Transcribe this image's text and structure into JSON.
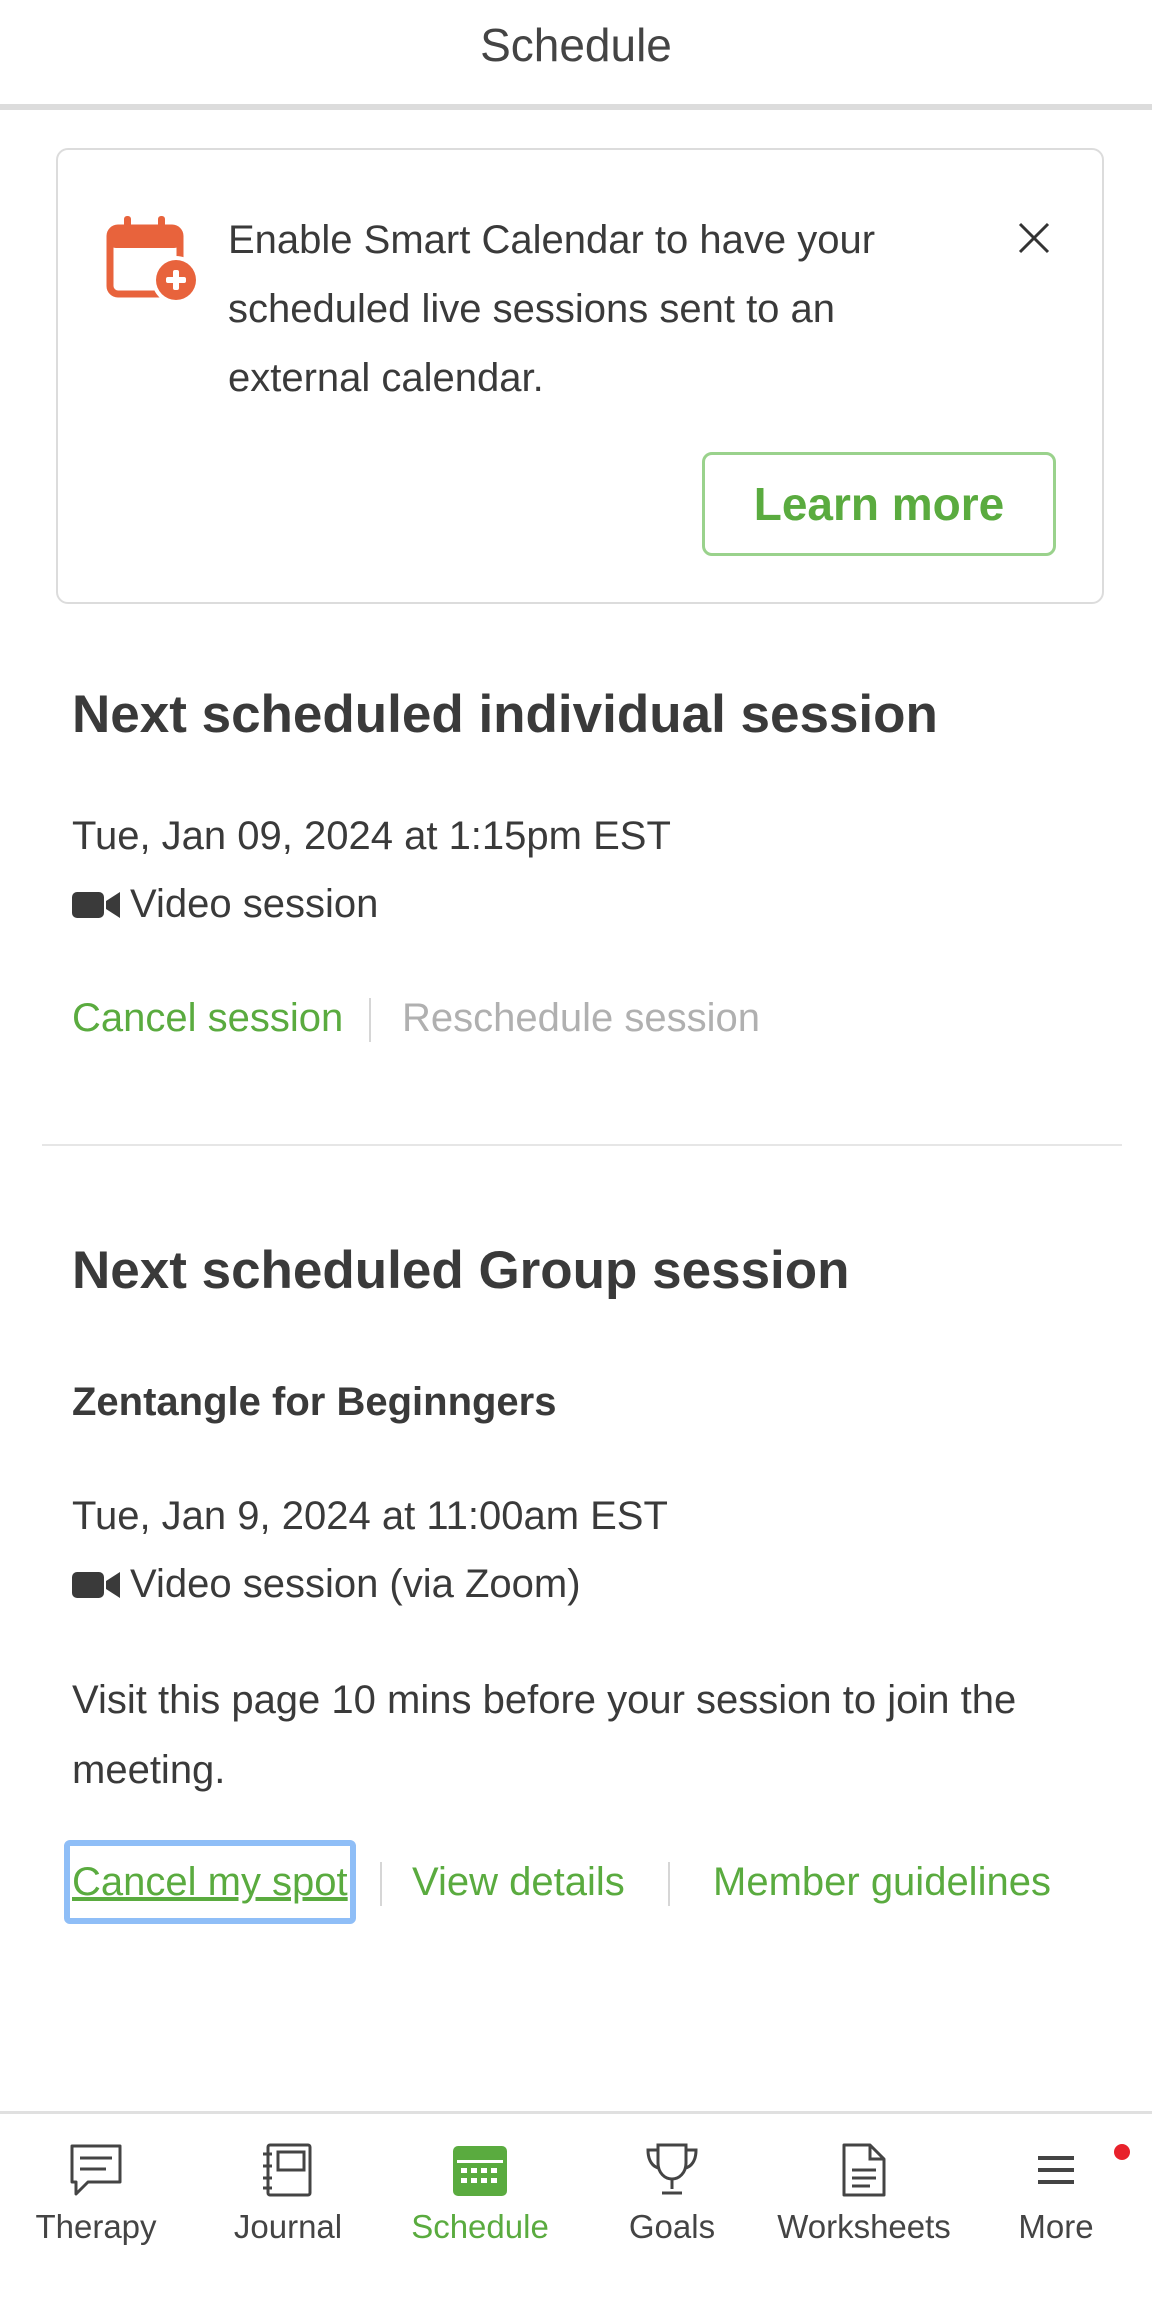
{
  "header": {
    "title": "Schedule"
  },
  "banner": {
    "text_line1": "Enable Smart Calendar to have your",
    "text_line2": "scheduled live sessions sent to an",
    "text_line3": "external calendar.",
    "learn_more_label": "Learn more",
    "icon": "calendar-add-icon",
    "accent_color": "#e8633c"
  },
  "individual": {
    "title": "Next scheduled individual session",
    "datetime": "Tue, Jan 09, 2024 at 1:15pm EST",
    "session_type": "Video session",
    "cancel_label": "Cancel session",
    "reschedule_label": "Reschedule session"
  },
  "group": {
    "title": "Next scheduled Group session",
    "name": "Zentangle for Beginngers",
    "datetime": "Tue, Jan 9, 2024 at 11:00am EST",
    "session_type": "Video session (via Zoom)",
    "note_line1": "Visit this page 10 mins before your session to join the",
    "note_line2": "meeting.",
    "cancel_label": "Cancel my spot",
    "details_label": "View details",
    "guidelines_label": "Member guidelines"
  },
  "nav": {
    "items": [
      {
        "label": "Therapy",
        "icon": "chat-icon"
      },
      {
        "label": "Journal",
        "icon": "journal-icon"
      },
      {
        "label": "Schedule",
        "icon": "calendar-icon",
        "active": true
      },
      {
        "label": "Goals",
        "icon": "trophy-icon"
      },
      {
        "label": "Worksheets",
        "icon": "document-icon"
      },
      {
        "label": "More",
        "icon": "menu-icon",
        "has_notification": true
      }
    ]
  },
  "colors": {
    "brand_green": "#5aab3f",
    "disabled": "#b0b0b0",
    "notification": "#e8212b"
  }
}
